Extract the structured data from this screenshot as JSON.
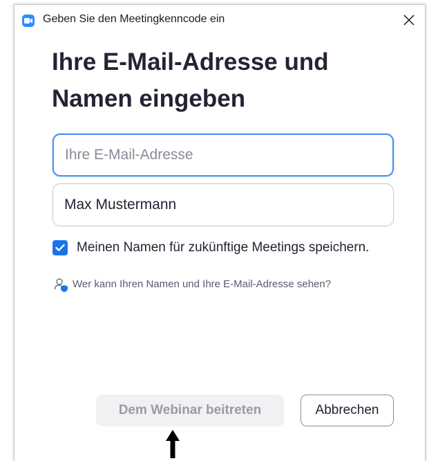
{
  "window": {
    "title": "Geben Sie den Meetingkenncode ein"
  },
  "heading": {
    "line1": "Ihre E-Mail-Adresse und",
    "line2": "Namen eingeben"
  },
  "form": {
    "email": {
      "placeholder": "Ihre E-Mail-Adresse",
      "value": ""
    },
    "name": {
      "placeholder": "",
      "value": "Max Mustermann"
    },
    "remember": {
      "label": "Meinen Namen für zukünftige Meetings speichern.",
      "checked": true
    },
    "privacy_link": "Wer kann Ihren Namen und Ihre E-Mail-Adresse sehen?"
  },
  "buttons": {
    "join": "Dem Webinar beitreten",
    "cancel": "Abbrechen"
  },
  "icons": {
    "app": "zoom-camera-icon",
    "close": "close-icon",
    "check": "check-icon",
    "privacy": "user-shield-icon",
    "annotation": "arrow-up-icon"
  },
  "colors": {
    "accent": "#1a73e8",
    "focus_border": "#4d8ff5",
    "app_icon": "#2d8cff",
    "disabled_bg": "#f1f1f4",
    "disabled_text": "#9a9aa4"
  }
}
